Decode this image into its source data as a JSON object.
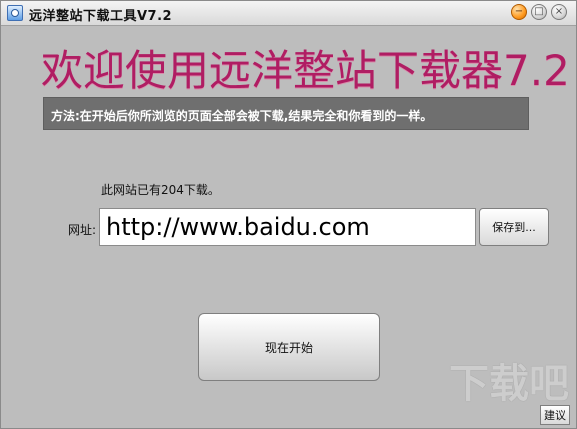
{
  "window": {
    "title": "远洋整站下载工具V7.2",
    "icon": "app-icon"
  },
  "titlebar": {
    "minimize_icon": "minimize-icon",
    "maximize_icon": "maximize-icon",
    "close_icon": "close-icon"
  },
  "banner": {
    "text": "欢迎使用远洋整站下载器7.2",
    "color": "#b01d63"
  },
  "tip": {
    "text": "方法:在开始后你所浏览的页面全部会被下载,结果完全和你看到的一样。"
  },
  "download": {
    "count_text": "此网站已有204下载。"
  },
  "url": {
    "label": "网址:",
    "value": "http://www.baidu.com"
  },
  "buttons": {
    "save_to": "保存到...",
    "start_now": "现在开始",
    "suggest": "建议"
  }
}
